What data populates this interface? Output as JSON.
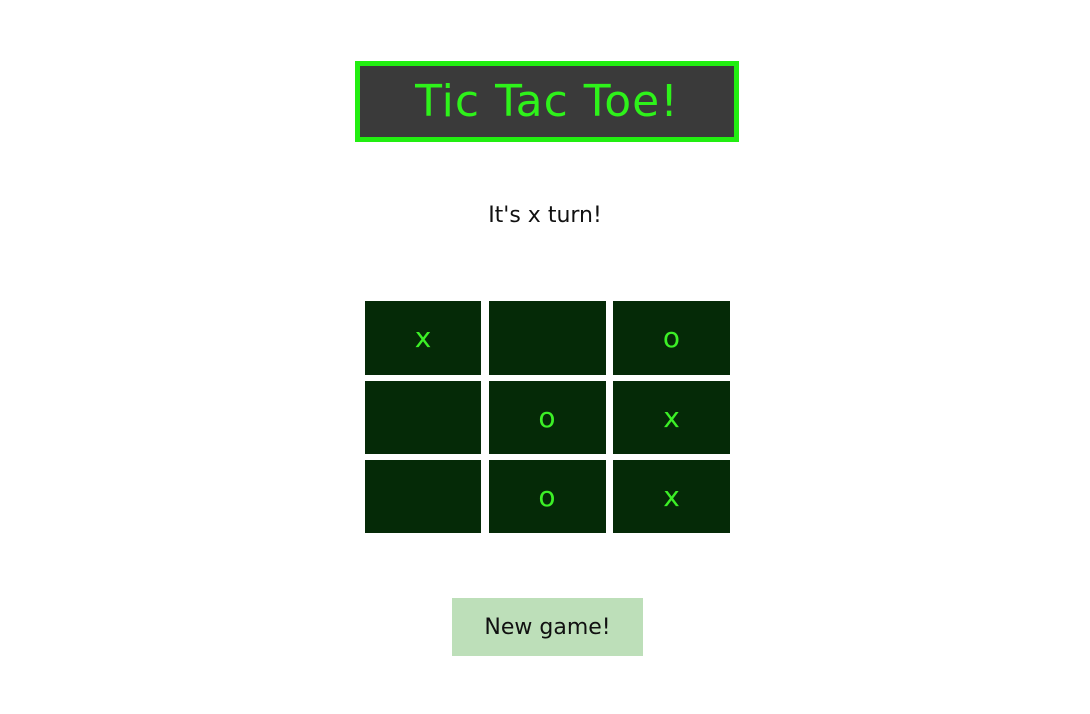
{
  "header": {
    "title": "Tic Tac Toe!"
  },
  "status": {
    "text": "It's x turn!"
  },
  "board": {
    "cells": [
      "x",
      "",
      "o",
      "",
      "o",
      "x",
      "",
      "o",
      "x"
    ]
  },
  "controls": {
    "new_game_label": "New game!"
  },
  "colors": {
    "title_text": "#2ef21a",
    "title_border": "#22ee11",
    "title_background": "#3a3a3a",
    "cell_background": "#052a07",
    "mark_color": "#3cf026",
    "button_background": "#bddfb9"
  }
}
